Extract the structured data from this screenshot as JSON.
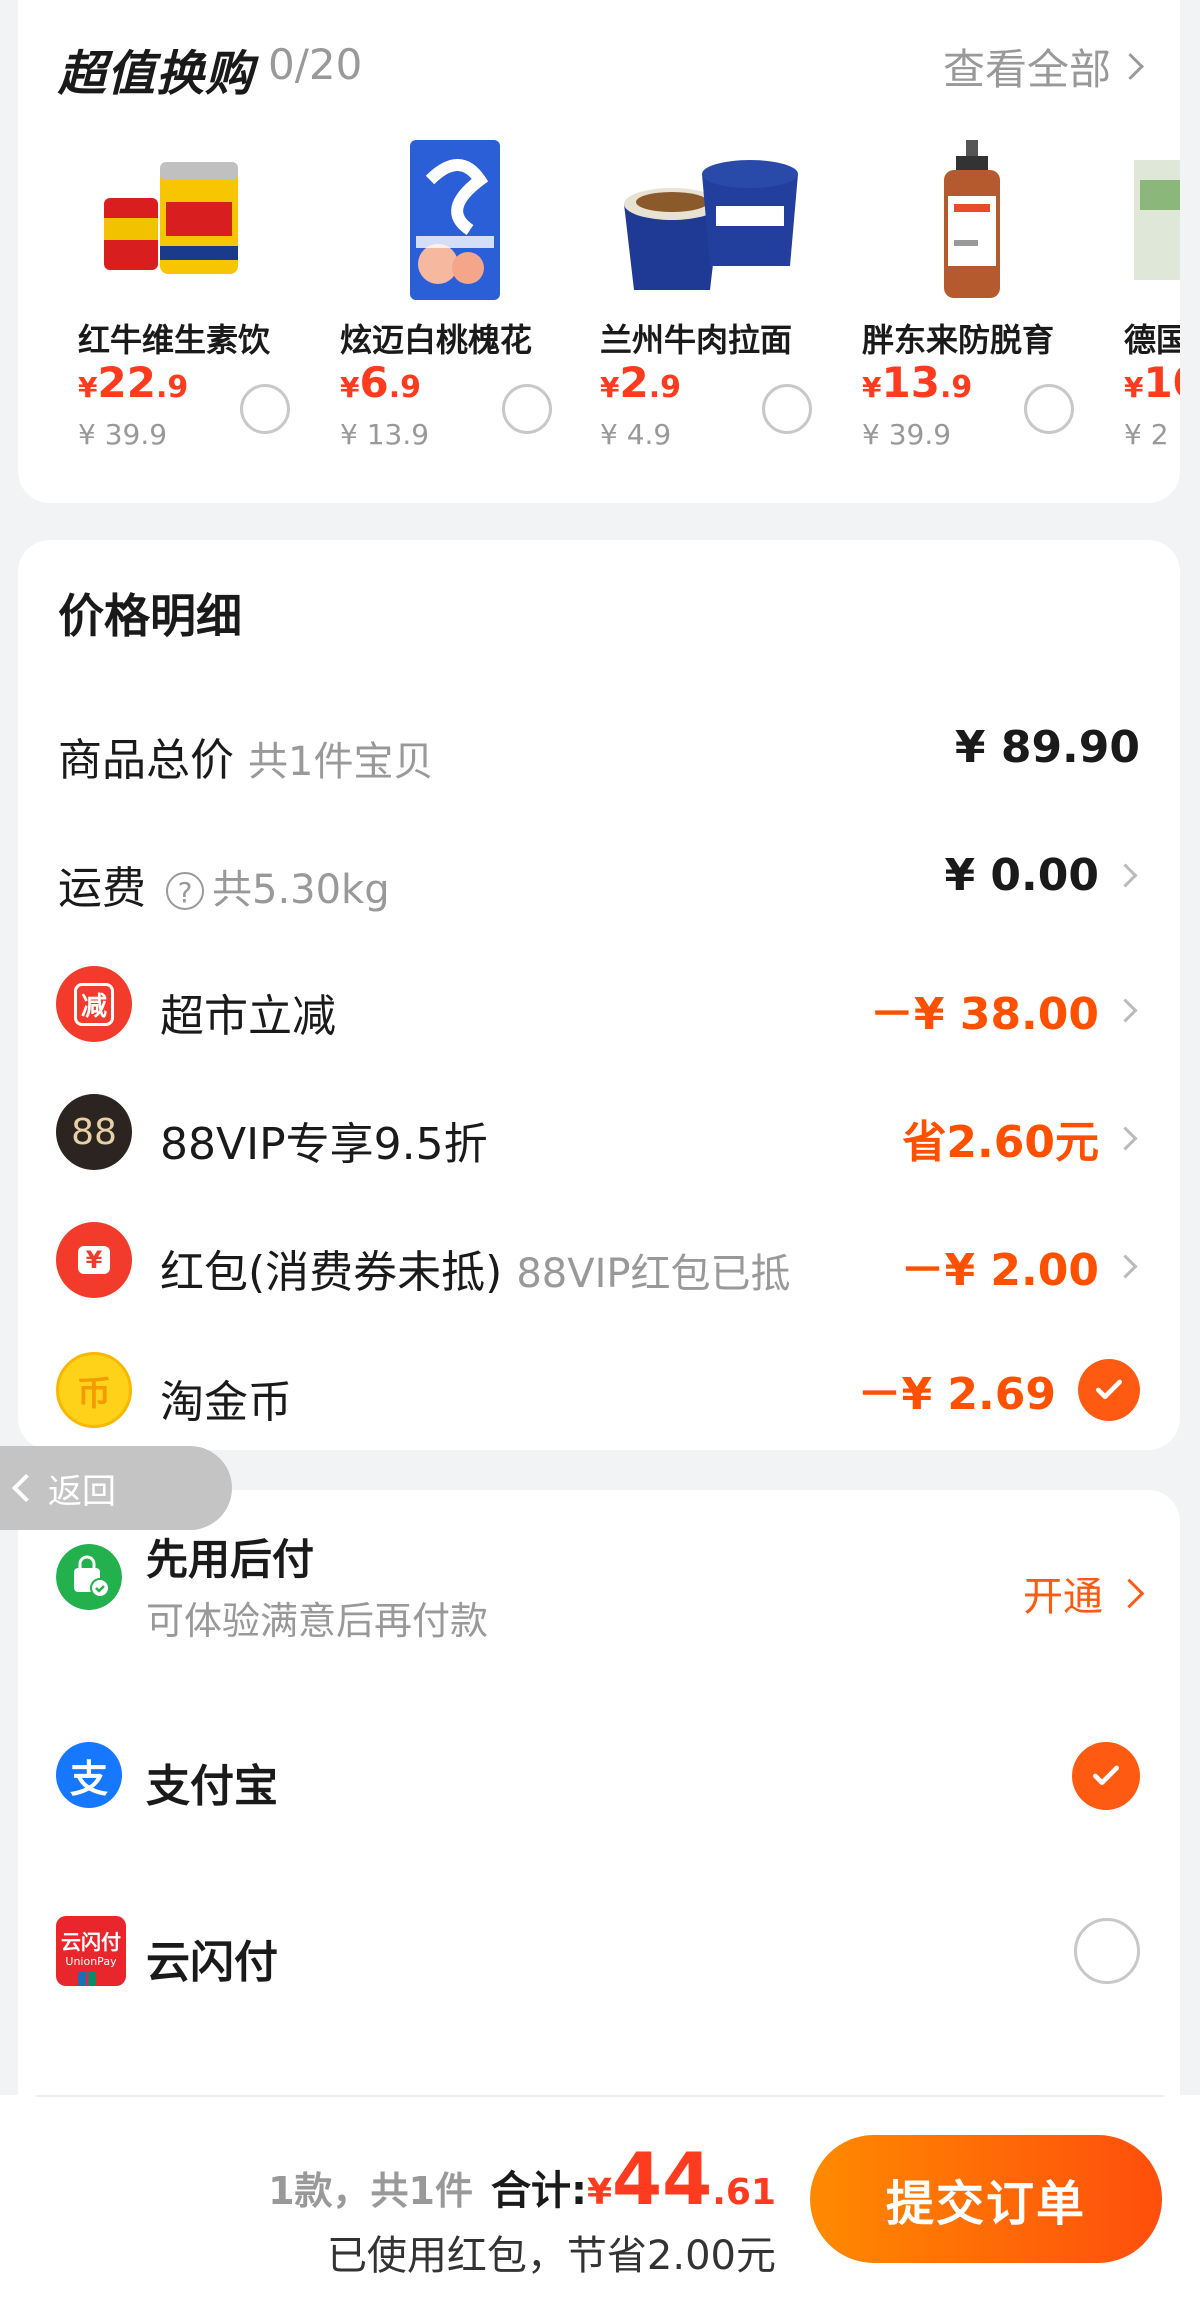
{
  "exchange": {
    "title": "超值换购",
    "count": "0/20",
    "view_all": "查看全部",
    "products": [
      {
        "name": "红牛维生素饮",
        "price_yen": "¥",
        "price_int": "22",
        "price_dec": ".9",
        "original": "¥ 39.9"
      },
      {
        "name": "炫迈白桃槐花",
        "price_yen": "¥",
        "price_int": "6",
        "price_dec": ".9",
        "original": "¥ 13.9"
      },
      {
        "name": "兰州牛肉拉面",
        "price_yen": "¥",
        "price_int": "2",
        "price_dec": ".9",
        "original": "¥ 4.9"
      },
      {
        "name": "胖东来防脱育",
        "price_yen": "¥",
        "price_int": "13",
        "price_dec": ".9",
        "original": "¥ 39.9"
      },
      {
        "name": "德国",
        "price_yen": "¥",
        "price_int": "10",
        "price_dec": "",
        "original": "¥ 2"
      }
    ]
  },
  "price_detail": {
    "title": "价格明细",
    "goods_total": {
      "label": "商品总价",
      "sub": "共1件宝贝",
      "value": "¥ 89.90"
    },
    "shipping": {
      "label": "运费",
      "help": "?",
      "sub": "共5.30kg",
      "value": "¥ 0.00"
    },
    "supermarket": {
      "icon_text": "减",
      "label": "超市立减",
      "value": "－¥ 38.00"
    },
    "vip": {
      "icon_text": "88",
      "label": "88VIP专享9.5折",
      "value": "省2.60元"
    },
    "hongbao": {
      "icon_text": "¥",
      "label": "红包(消费券未抵)",
      "sub": "88VIP红包已抵",
      "value": "－¥ 2.00"
    },
    "taojinbi": {
      "icon_text": "币",
      "label": "淘金币",
      "value": "－¥ 2.69"
    }
  },
  "back_label": "返回",
  "payment": {
    "later": {
      "title": "先用后付",
      "desc": "可体验满意后再付款",
      "action": "开通"
    },
    "alipay": {
      "icon_text": "支",
      "name": "支付宝"
    },
    "unionpay": {
      "icon_text": "云闪付",
      "icon_sub": "UnionPay",
      "name": "云闪付"
    }
  },
  "bottom": {
    "count_text": "1款，共1件",
    "total_label": "合计:",
    "total_yen": "¥",
    "total_int": "44",
    "total_dec": ".61",
    "saving_text": "已使用红包，节省2.00元",
    "submit": "提交订单"
  },
  "colors": {
    "accent": "#ff5000",
    "price_red": "#ff3b1f",
    "alipay_blue": "#1677ff",
    "later_green": "#22b14c"
  }
}
